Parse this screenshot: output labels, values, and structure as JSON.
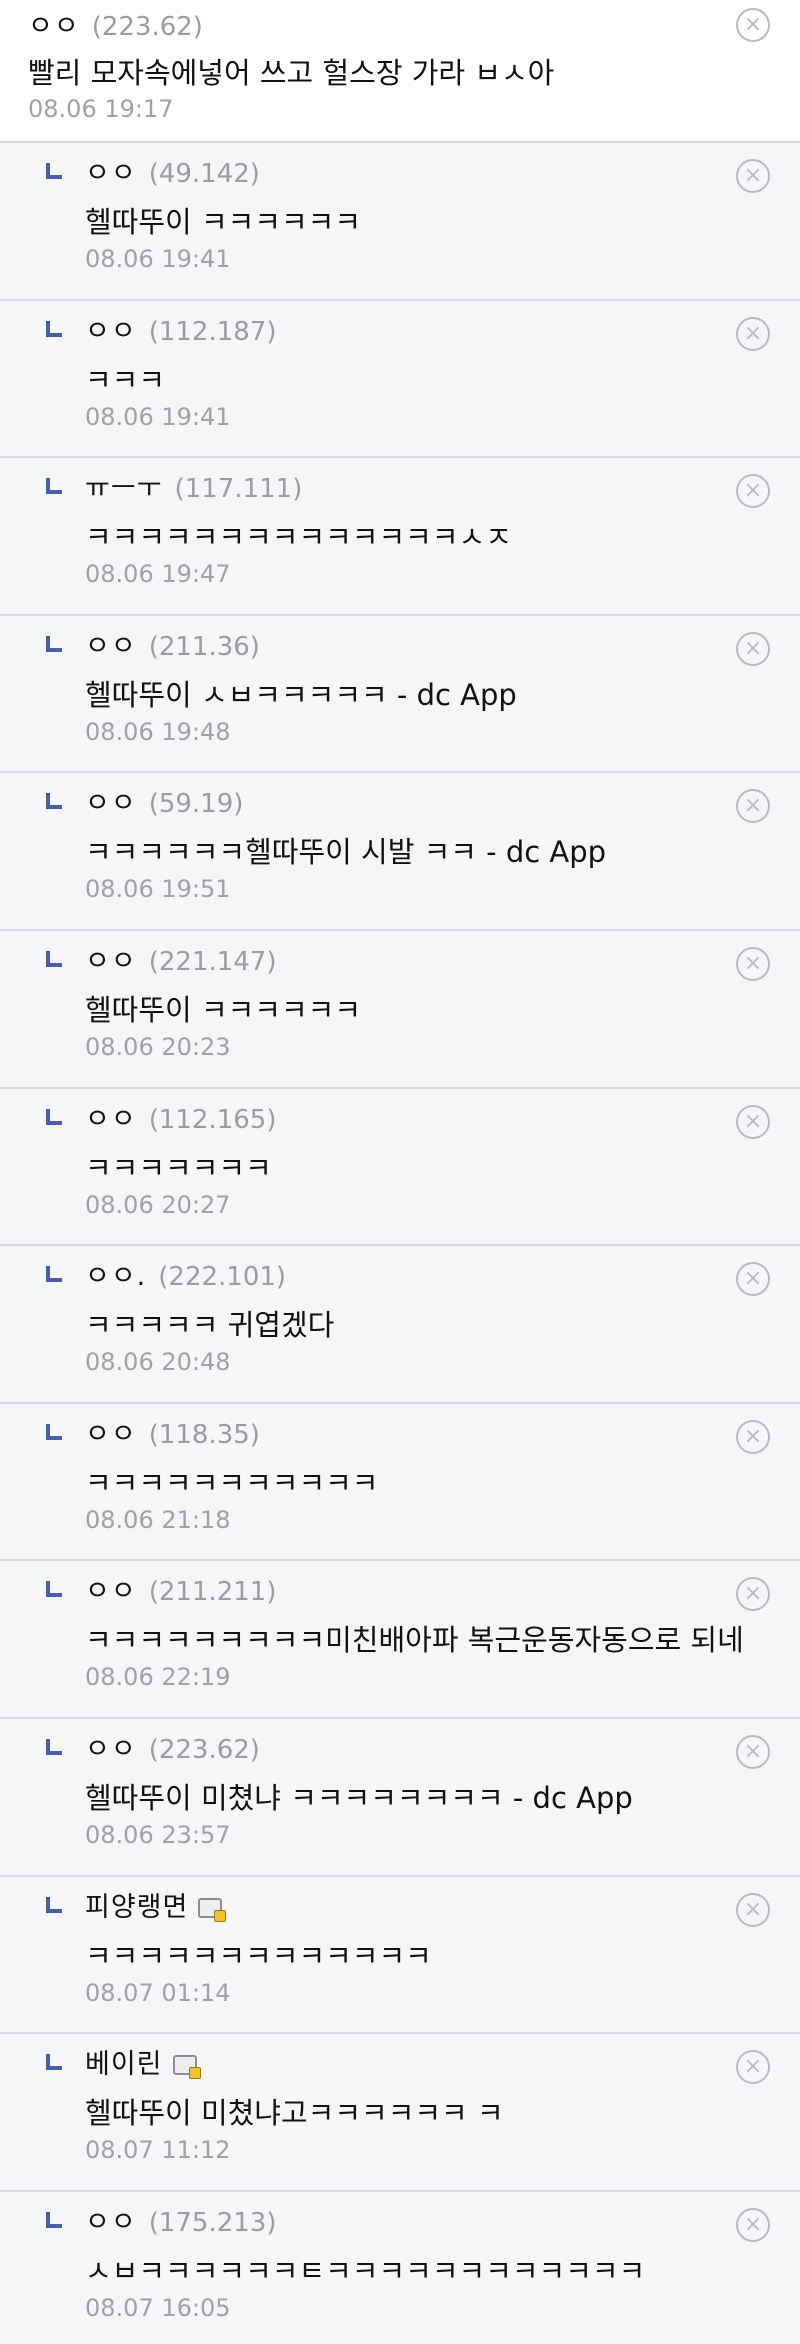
{
  "comments": [
    {
      "nick": "ㅇㅇ",
      "ip": "(223.62)",
      "text": "빨리 모자속에넣어 쓰고 헐스장 가라 ㅂㅅ아",
      "date": "08.06 19:17",
      "reply": false,
      "icon": false
    },
    {
      "nick": "ㅇㅇ",
      "ip": "(49.142)",
      "text": "헬따뚜이 ㅋㅋㅋㅋㅋㅋ",
      "date": "08.06 19:41",
      "reply": true,
      "icon": false
    },
    {
      "nick": "ㅇㅇ",
      "ip": "(112.187)",
      "text": "ㅋㅋㅋ",
      "date": "08.06 19:41",
      "reply": true,
      "icon": false
    },
    {
      "nick": "ㅠㅡㅜ",
      "ip": "(117.111)",
      "text": "ㅋㅋㅋㅋㅋㅋㅋㅋㅋㅋㅋㅋㅋㅋㅅㅈ",
      "date": "08.06 19:47",
      "reply": true,
      "icon": false
    },
    {
      "nick": "ㅇㅇ",
      "ip": "(211.36)",
      "text": "헬따뚜이 ㅅㅂㅋㅋㅋㅋㅋ - dc App",
      "date": "08.06 19:48",
      "reply": true,
      "icon": false
    },
    {
      "nick": "ㅇㅇ",
      "ip": "(59.19)",
      "text": "ㅋㅋㅋㅋㅋㅋ헬따뚜이 시발 ㅋㅋ - dc App",
      "date": "08.06 19:51",
      "reply": true,
      "icon": false
    },
    {
      "nick": "ㅇㅇ",
      "ip": "(221.147)",
      "text": "헬따뚜이 ㅋㅋㅋㅋㅋㅋ",
      "date": "08.06 20:23",
      "reply": true,
      "icon": false
    },
    {
      "nick": "ㅇㅇ",
      "ip": "(112.165)",
      "text": "ㅋㅋㅋㅋㅋㅋㅋ",
      "date": "08.06 20:27",
      "reply": true,
      "icon": false
    },
    {
      "nick": "ㅇㅇ.",
      "ip": "(222.101)",
      "text": "ㅋㅋㅋㅋㅋ 귀엽겠다",
      "date": "08.06 20:48",
      "reply": true,
      "icon": false
    },
    {
      "nick": "ㅇㅇ",
      "ip": "(118.35)",
      "text": "ㅋㅋㅋㅋㅋㅋㅋㅋㅋㅋㅋ",
      "date": "08.06 21:18",
      "reply": true,
      "icon": false
    },
    {
      "nick": "ㅇㅇ",
      "ip": "(211.211)",
      "text": "ㅋㅋㅋㅋㅋㅋㅋㅋㅋ미친배아파 복근운동자동으로 되네",
      "date": "08.06 22:19",
      "reply": true,
      "icon": false
    },
    {
      "nick": "ㅇㅇ",
      "ip": "(223.62)",
      "text": "헬따뚜이 미쳤냐 ㅋㅋㅋㅋㅋㅋㅋㅋ - dc App",
      "date": "08.06 23:57",
      "reply": true,
      "icon": false
    },
    {
      "nick": "피양랭면",
      "ip": "",
      "text": "ㅋㅋㅋㅋㅋㅋㅋㅋㅋㅋㅋㅋㅋ",
      "date": "08.07 01:14",
      "reply": true,
      "icon": true
    },
    {
      "nick": "베이린",
      "ip": "",
      "text": "헬따뚜이 미쳤냐고ㅋㅋㅋㅋㅋㅋ ㅋ",
      "date": "08.07 11:12",
      "reply": true,
      "icon": true
    },
    {
      "nick": "ㅇㅇ",
      "ip": "(175.213)",
      "text": "ㅅㅂㅋㅋㅋㅋㅋㅋㅌㅋㅋㅋㅋㅋㅋㅋㅋㅋㅋㅋㅋ",
      "date": "08.07 16:05",
      "reply": true,
      "icon": false
    }
  ],
  "delete_glyph": "×",
  "colors": {
    "reply_bg": "#f5f6f8",
    "reply_mark": "#4a5ea8",
    "ip": "#9a9ca2",
    "date": "#9ea1a6"
  }
}
